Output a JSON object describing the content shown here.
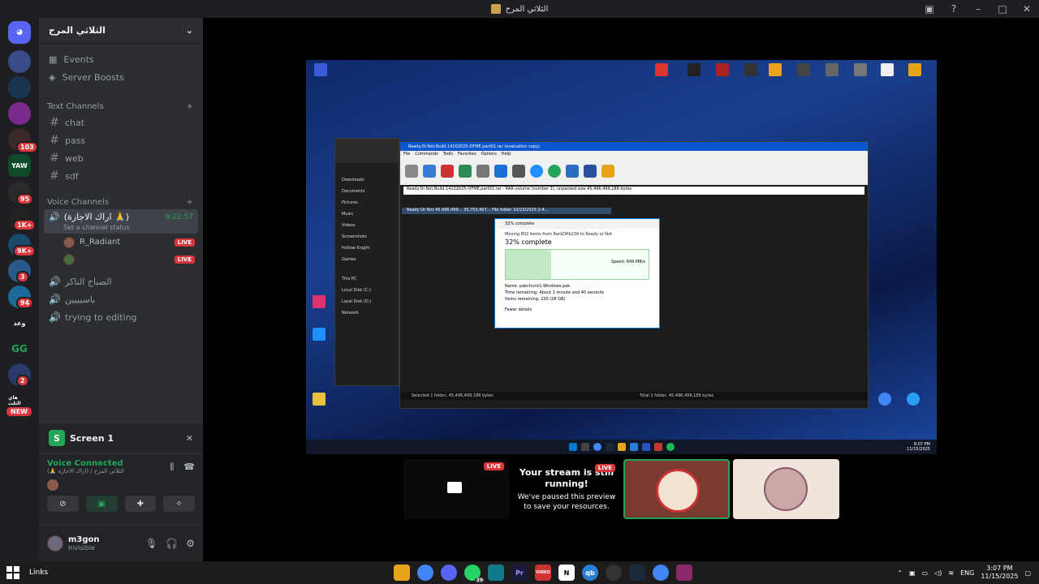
{
  "window": {
    "title": "الثلاثي المرح"
  },
  "server": {
    "name": "الثلاثي المرح"
  },
  "guild_badges": [
    "103",
    "95",
    "1K+",
    "9K+",
    "3",
    "94",
    "2"
  ],
  "guild_new": "NEW",
  "nav": {
    "events": "Events",
    "boosts": "Server Boosts"
  },
  "text_channels": {
    "label": "Text Channels",
    "items": [
      "chat",
      "pass",
      "web",
      "sdf"
    ]
  },
  "voice_channels": {
    "label": "Voice Channels",
    "active": {
      "name": "(اراك الاجازة 🙏)",
      "timer": "9:22:57",
      "status": "Set a channel status"
    },
    "users": [
      {
        "name": "R_Radiant",
        "live": "LIVE"
      },
      {
        "name": "",
        "live": "LIVE"
      }
    ],
    "other": [
      "الصباح الناكر",
      "باسيييين",
      "trying to editing"
    ]
  },
  "screen_panel": {
    "label": "Screen 1"
  },
  "voice": {
    "status": "Voice Connected",
    "channel": "الثلاثي المرح / (اراك الاجازة 🙏)"
  },
  "me": {
    "name": "m3gon",
    "status": "Invisible"
  },
  "stream": {
    "live": "LIVE",
    "heading": "Your stream is still running!",
    "body": "We've paused this preview to save your resources."
  },
  "shared": {
    "winrar_title": "Ready.Or.Not.Build.14102025-OFME.part01.rar (evaluation copy)",
    "menu": [
      "File",
      "Commands",
      "Tools",
      "Favorites",
      "Options",
      "Help"
    ],
    "path": "Ready.Or.Not.Build.14102025-OFME.part01.rar - RAR volume (number 1), unpacked size 45,496,499,186 bytes",
    "selected_row": "Ready Or Not   45,496,499...  35,753,407...  File folder   10/23/2025 2:4...",
    "footer_left": "Selected 1 folder, 45,496,499,186 bytes",
    "footer_right": "Total 1 folder, 45,496,499,186 bytes",
    "explorer_items": [
      "Downloads",
      "Documents",
      "Pictures",
      "Music",
      "Videos",
      "Screenshots",
      "Hollow Knight",
      "Games",
      "This PC",
      "Local Disk (C:)",
      "Local Disk (D:)",
      "Network"
    ],
    "dialog": {
      "title": "32% complete",
      "moving": "Moving 802 items from Rar$DRb234 to Ready or Not",
      "pct": "32% complete",
      "speed": "Speed: 649 MB/s",
      "name": "Name: pakchunk1-Windows.pak",
      "time": "Time remaining: About 1 minute and 40 seconds",
      "items": "Items remaining: 230 (28 GB)",
      "more": "Fewer details"
    },
    "clock_time": "8:07 PM",
    "clock_date": "11/15/2025"
  },
  "taskbar": {
    "links": "Links",
    "time": "3:07 PM",
    "date": "11/15/2025",
    "lang": "ENG",
    "whatsapp_badge": "39"
  },
  "colors": {
    "green": "#23a55a",
    "red": "#da373c",
    "blurple": "#5865f2"
  }
}
